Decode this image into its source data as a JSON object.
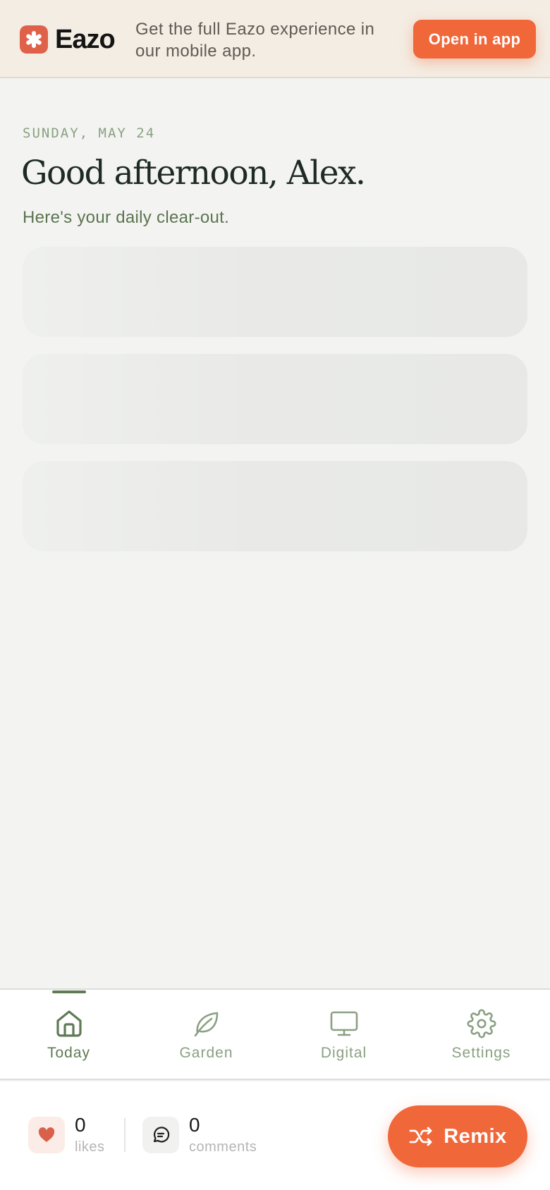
{
  "banner": {
    "brand": "Eazo",
    "message": "Get the full Eazo experience in our mobile app.",
    "open_label": "Open in app"
  },
  "header": {
    "date": "SUNDAY, MAY 24",
    "greeting": "Good afternoon, Alex.",
    "subtitle": "Here's your daily clear-out."
  },
  "nav": {
    "items": [
      {
        "label": "Today",
        "icon": "home-icon",
        "active": true
      },
      {
        "label": "Garden",
        "icon": "leaf-icon",
        "active": false
      },
      {
        "label": "Digital",
        "icon": "monitor-icon",
        "active": false
      },
      {
        "label": "Settings",
        "icon": "gear-icon",
        "active": false
      }
    ]
  },
  "footer": {
    "likes_count": "0",
    "likes_label": "likes",
    "comments_count": "0",
    "comments_label": "comments",
    "remix_label": "Remix"
  },
  "colors": {
    "accent": "#f0673a",
    "brand_mark": "#e0614a",
    "nav_active": "#5f7a55",
    "nav_inactive": "#8aa082",
    "banner_bg": "#f4ede3",
    "page_bg": "#f3f4f2"
  }
}
